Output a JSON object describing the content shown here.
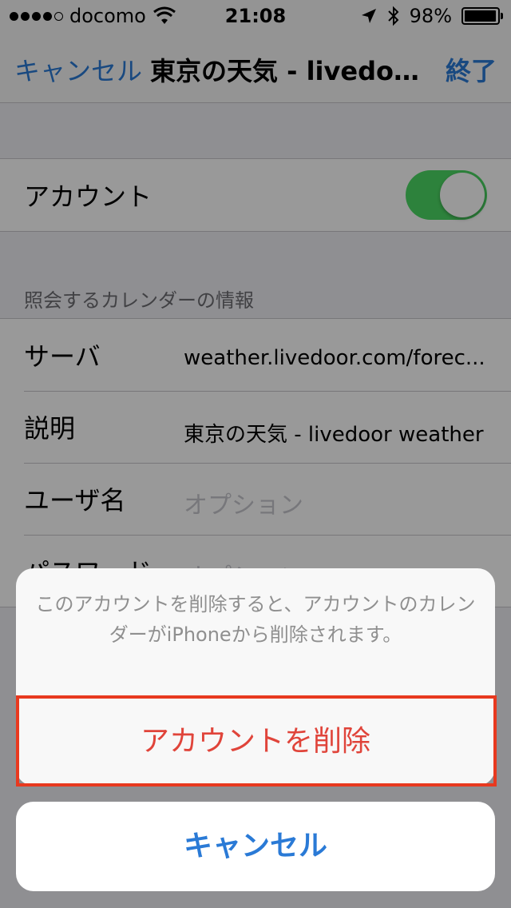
{
  "status_bar": {
    "carrier": "docomo",
    "time": "21:08",
    "battery": "98%",
    "battery_level": 0.98,
    "signal_dots": 5,
    "signal_filled": 4
  },
  "nav": {
    "cancel_label": "キャンセル",
    "title": "東京の天気 - livedoor...",
    "done_label": "終了"
  },
  "account_row": {
    "label": "アカウント",
    "toggle_on": true
  },
  "section_header": "照会するカレンダーの情報",
  "rows": [
    {
      "label": "サーバ",
      "value": "weather.livedoor.com/forec..."
    },
    {
      "label": "説明",
      "value": "東京の天気 - livedoor weather"
    },
    {
      "label": "ユーザ名",
      "placeholder": "オプション"
    },
    {
      "label": "パスワード",
      "placeholder": "オプション"
    }
  ],
  "action_sheet": {
    "message": "このアカウントを削除すると、アカウントのカレンダーがiPhoneから削除されます。",
    "delete_label": "アカウントを削除",
    "cancel_label": "キャンセル"
  },
  "colors": {
    "accent": "#2a7ad6",
    "toggle_on": "#4cd964",
    "destructive": "#e0443a",
    "highlight_box": "#e8391f"
  }
}
